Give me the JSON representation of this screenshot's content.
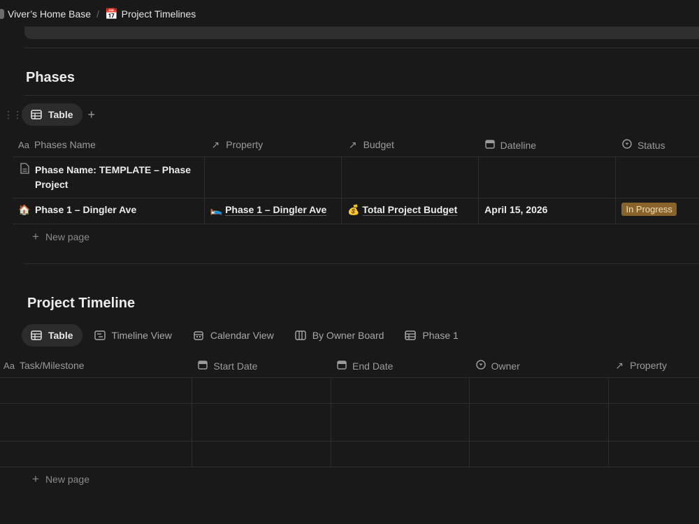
{
  "breadcrumb": {
    "workspace": "Viver’s Home Base",
    "separator": "/",
    "page_emoji": "📅",
    "page": "Project Timelines"
  },
  "phases": {
    "title": "Phases",
    "tab": "Table",
    "add_view": "+",
    "columns": [
      "Phases Name",
      "Property",
      "Budget",
      "Dateline",
      "Status"
    ],
    "column_icons": [
      "text-type-icon",
      "relation-arrow-icon",
      "relation-arrow-icon",
      "calendar-icon",
      "status-icon"
    ],
    "rows": [
      {
        "icon": "page-icon",
        "name": "Phase Name: TEMPLATE – Phase Project",
        "property": "",
        "budget": "",
        "dateline": "",
        "status": ""
      },
      {
        "icon": "🏠",
        "name": "Phase 1 – Dingler Ave",
        "property_emoji": "🛌",
        "property": "Phase 1 – Dingler Ave",
        "budget_emoji": "💰",
        "budget": "Total Project Budget",
        "dateline": "April 15, 2026",
        "status": "In Progress"
      }
    ],
    "new_page": "New page"
  },
  "timeline": {
    "title": "Project Timeline",
    "tabs": [
      {
        "label": "Table",
        "icon": "table-icon",
        "active": true
      },
      {
        "label": "Timeline View",
        "icon": "timeline-icon",
        "active": false
      },
      {
        "label": "Calendar View",
        "icon": "calendar-icon",
        "active": false
      },
      {
        "label": "By Owner Board",
        "icon": "board-icon",
        "active": false
      },
      {
        "label": "Phase 1",
        "icon": "table-icon",
        "active": false
      }
    ],
    "columns": [
      "Task/Milestone",
      "Start Date",
      "End Date",
      "Owner",
      "Property"
    ],
    "new_page": "New page"
  },
  "colors": {
    "background": "#191919",
    "status_in_progress": "#89632a"
  }
}
